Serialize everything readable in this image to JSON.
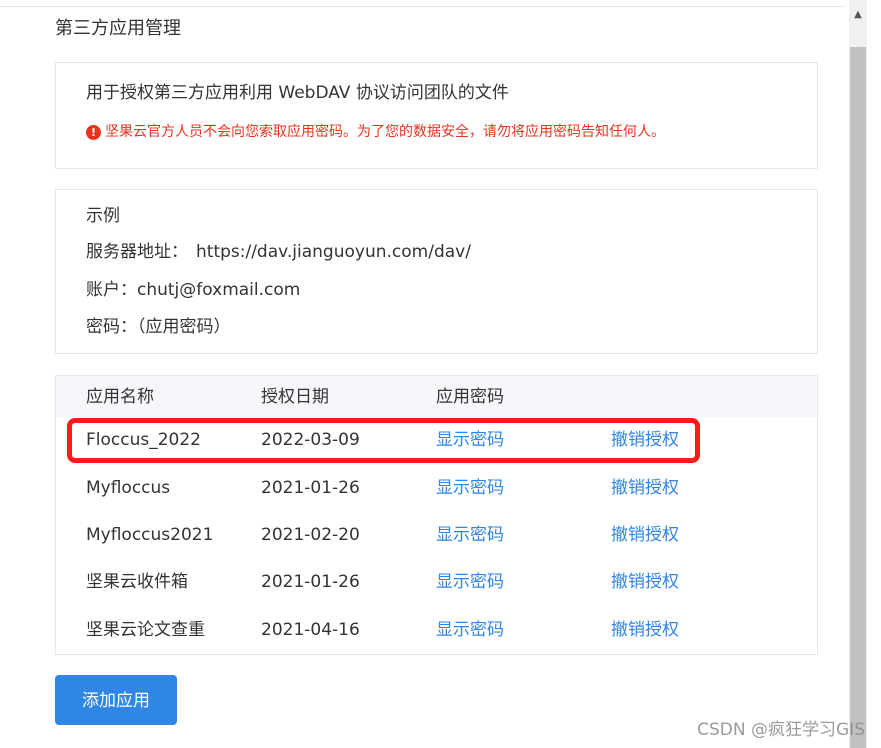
{
  "section_title": "第三方应用管理",
  "description": {
    "text": "用于授权第三方应用利用 WebDAV 协议访问团队的文件",
    "warning_icon": "exclamation-circle-icon",
    "warning": "坚果云官方人员不会向您索取应用密码。为了您的数据安全，请勿将应用密码告知任何人。",
    "warning_color": "#e8341f"
  },
  "example": {
    "title": "示例",
    "server_label": "服务器地址：",
    "server_value": "https://dav.jianguoyun.com/dav/",
    "account_label": "账户：",
    "account_value": "chutj@foxmail.com",
    "password_label": "密码：",
    "password_value": "（应用密码）"
  },
  "table": {
    "headers": [
      "应用名称",
      "授权日期",
      "应用密码",
      ""
    ],
    "rows": [
      {
        "name": "Floccus_2022",
        "date": "2022-03-09",
        "show": "显示密码",
        "revoke": "撤销授权"
      },
      {
        "name": "Myfloccus",
        "date": "2021-01-26",
        "show": "显示密码",
        "revoke": "撤销授权"
      },
      {
        "name": "Myfloccus2021",
        "date": "2021-02-20",
        "show": "显示密码",
        "revoke": "撤销授权"
      },
      {
        "name": "坚果云收件箱",
        "date": "2021-01-26",
        "show": "显示密码",
        "revoke": "撤销授权"
      },
      {
        "name": "坚果云论文查重",
        "date": "2021-04-16",
        "show": "显示密码",
        "revoke": "撤销授权"
      }
    ]
  },
  "add_button": "添加应用",
  "watermark": "CSDN @疯狂学习GIS",
  "colors": {
    "link": "#2f86e5",
    "button": "#2f86e5",
    "highlight": "#ff1a1a"
  }
}
